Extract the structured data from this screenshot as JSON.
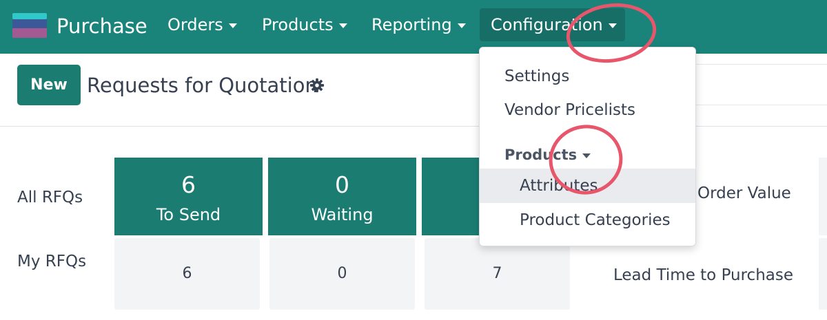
{
  "app": {
    "name": "Purchase",
    "icon": "purchase-app-icon"
  },
  "navbar": {
    "color": "#1b847a",
    "items": [
      {
        "label": "Orders"
      },
      {
        "label": "Products"
      },
      {
        "label": "Reporting"
      },
      {
        "label": "Configuration",
        "active": true
      }
    ]
  },
  "control_panel": {
    "new_label": "New",
    "title": "Requests for Quotation",
    "gear_icon": "gear-icon"
  },
  "dashboard": {
    "row_labels": [
      "All RFQs",
      "My RFQs"
    ],
    "tiles": [
      {
        "value": "6",
        "label": "To Send"
      },
      {
        "value": "0",
        "label": "Waiting"
      },
      {
        "value": "",
        "label": ""
      }
    ],
    "my_values": [
      "6",
      "0",
      "7"
    ],
    "kpis": [
      "Order Value",
      "Lead Time to Purchase"
    ],
    "accent": "#1b7d72"
  },
  "dropdown": {
    "items": [
      {
        "label": "Settings"
      },
      {
        "label": "Vendor Pricelists"
      }
    ],
    "section_header": "Products",
    "section_items": [
      {
        "label": "Attributes",
        "highlighted": true
      },
      {
        "label": "Product Categories"
      }
    ]
  },
  "annotations": {
    "circle_color": "#e8566c"
  }
}
